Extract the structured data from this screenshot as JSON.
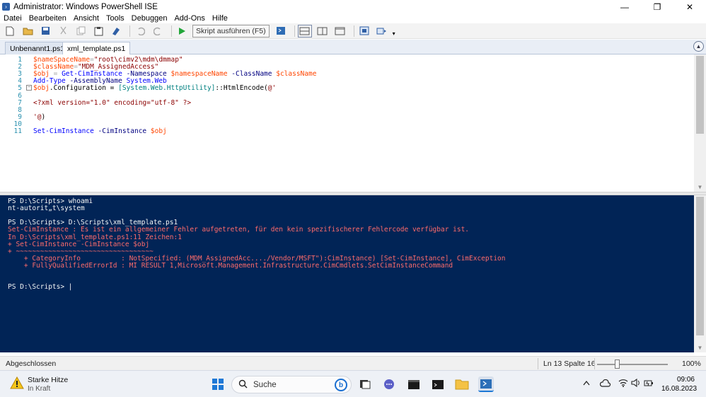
{
  "window": {
    "title": "Administrator: Windows PowerShell ISE",
    "controls": [
      "—",
      "❐",
      "✕"
    ]
  },
  "menu": [
    "Datei",
    "Bearbeiten",
    "Ansicht",
    "Tools",
    "Debuggen",
    "Add-Ons",
    "Hilfe"
  ],
  "toolbar": {
    "run_selection_label": "Skript ausführen (F5)"
  },
  "tabs": [
    {
      "label": "Unbenannt1.ps1",
      "active": false
    },
    {
      "label": "xml_template.ps1",
      "active": true
    }
  ],
  "editor": {
    "line_numbers": [
      "1",
      "2",
      "3",
      "4",
      "5",
      "6",
      "7",
      "8",
      "9",
      "10",
      "11"
    ],
    "lines": [
      [
        {
          "t": "$nameSpaceName",
          "c": "var"
        },
        {
          "t": "=",
          "c": "op"
        },
        {
          "t": "\"root\\cimv2\\mdm\\dmmap\"",
          "c": "str"
        }
      ],
      [
        {
          "t": "$className",
          "c": "var"
        },
        {
          "t": "=",
          "c": "op"
        },
        {
          "t": "\"MDM_AssignedAccess\"",
          "c": "str"
        }
      ],
      [
        {
          "t": "$obj",
          "c": "var"
        },
        {
          "t": " = ",
          "c": "op"
        },
        {
          "t": "Get-CimInstance",
          "c": "cmd"
        },
        {
          "t": " -Namespace ",
          "c": "par"
        },
        {
          "t": "$namespaceName",
          "c": "var"
        },
        {
          "t": " -ClassName ",
          "c": "par"
        },
        {
          "t": "$className",
          "c": "var"
        }
      ],
      [
        {
          "t": "Add-Type",
          "c": "cmd"
        },
        {
          "t": " -AssemblyName ",
          "c": "par"
        },
        {
          "t": "System.Web",
          "c": "cmd"
        }
      ],
      [
        {
          "t": "$obj",
          "c": "var"
        },
        {
          "t": ".Configuration = ",
          "c": "mem"
        },
        {
          "t": "[System.Web.HttpUtility]",
          "c": "typ"
        },
        {
          "t": "::HtmlEncode(",
          "c": "mem"
        },
        {
          "t": "@'",
          "c": "hs"
        }
      ],
      [],
      [
        {
          "t": "<?xml version=\"1.0\" encoding=\"utf-8\" ?>",
          "c": "hs"
        }
      ],
      [],
      [
        {
          "t": "'@",
          "c": "hs"
        },
        {
          "t": ")",
          "c": "mem"
        }
      ],
      [],
      [
        {
          "t": "Set-CimInstance",
          "c": "cmd"
        },
        {
          "t": " -CimInstance ",
          "c": "par"
        },
        {
          "t": "$obj",
          "c": "var"
        }
      ]
    ]
  },
  "console": {
    "lines": [
      {
        "t": "PS D:\\Scripts> whoami",
        "err": false
      },
      {
        "t": "nt-autorit„t\\system",
        "err": false
      },
      {
        "t": "",
        "err": false
      },
      {
        "t": "PS D:\\Scripts> D:\\Scripts\\xml_template.ps1",
        "err": false
      },
      {
        "t": "Set-CimInstance : Es ist ein allgemeiner Fehler aufgetreten, für den kein spezifischerer Fehlercode verfügbar ist.",
        "err": true
      },
      {
        "t": "In D:\\Scripts\\xml_template.ps1:11 Zeichen:1",
        "err": true
      },
      {
        "t": "+ Set-CimInstance -CimInstance $obj",
        "err": true
      },
      {
        "t": "+ ~~~~~~~~~~~~~~~~~~~~~~~~~~~~~~~~~~",
        "err": true
      },
      {
        "t": "    + CategoryInfo          : NotSpecified: (MDM_AssignedAcc..../Vendor/MSFT\"):CimInstance) [Set-CimInstance], CimException",
        "err": true
      },
      {
        "t": "    + FullyQualifiedErrorId : MI RESULT 1,Microsoft.Management.Infrastructure.CimCmdlets.SetCimInstanceCommand",
        "err": true
      },
      {
        "t": "",
        "err": false
      },
      {
        "t": "",
        "err": false
      },
      {
        "t": "PS D:\\Scripts> |",
        "err": false
      }
    ]
  },
  "status": {
    "text": "Abgeschlossen",
    "position": "Ln 13  Spalte 16",
    "zoom": "100%"
  },
  "taskbar": {
    "weather_title": "Starke Hitze",
    "weather_sub": "In Kraft",
    "search_placeholder": "Suche",
    "time": "09:06",
    "date": "16.08.2023"
  }
}
